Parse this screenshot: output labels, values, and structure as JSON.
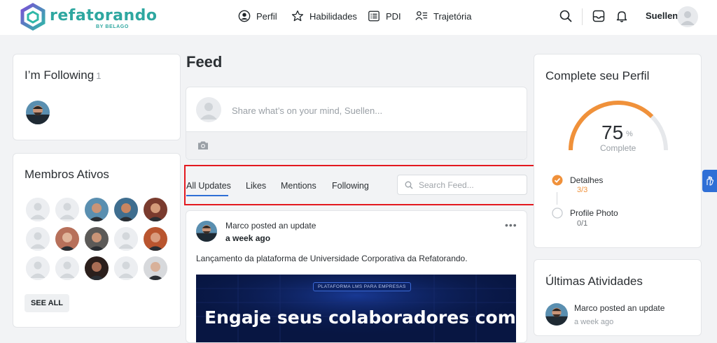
{
  "brand": {
    "name": "refatorando",
    "sub": "BY BELAGO",
    "color": "#2ea7a0"
  },
  "nav": {
    "items": [
      {
        "label": "Perfil",
        "icon": "user-circle-icon"
      },
      {
        "label": "Habilidades",
        "icon": "star-icon"
      },
      {
        "label": "PDI",
        "icon": "list-box-icon"
      },
      {
        "label": "Trajetória",
        "icon": "user-list-icon"
      }
    ],
    "user": "Suellen"
  },
  "following": {
    "title": "I’m Following",
    "count": "1"
  },
  "members": {
    "title": "Membros Ativos",
    "see_all": "SEE ALL"
  },
  "feed": {
    "title": "Feed",
    "compose_placeholder": "Share what’s on your mind, Suellen...",
    "tabs": [
      "All Updates",
      "Likes",
      "Mentions",
      "Following"
    ],
    "search_placeholder": "Search Feed...",
    "post": {
      "author": "Marco",
      "action": "posted an update",
      "time": "a week ago",
      "body": "Lançamento da plataforma de Universidade Corporativa da Refatorando.",
      "banner_tag": "PLATAFORMA LMS PARA EMPRESAS",
      "banner_headline": "Engaje seus colaboradores com uma"
    }
  },
  "profile": {
    "title": "Complete seu Perfil",
    "percent": "75",
    "percent_sign": "%",
    "percent_value": 0.75,
    "complete_label": "Complete",
    "accent": "#f0913a",
    "steps": [
      {
        "label": "Detalhes",
        "progress": "3/3",
        "done": true
      },
      {
        "label": "Profile Photo",
        "progress": "0/1",
        "done": false
      }
    ]
  },
  "activity": {
    "title": "Últimas Atividades",
    "author": "Marco",
    "action": "posted an update",
    "time": "a week ago"
  }
}
